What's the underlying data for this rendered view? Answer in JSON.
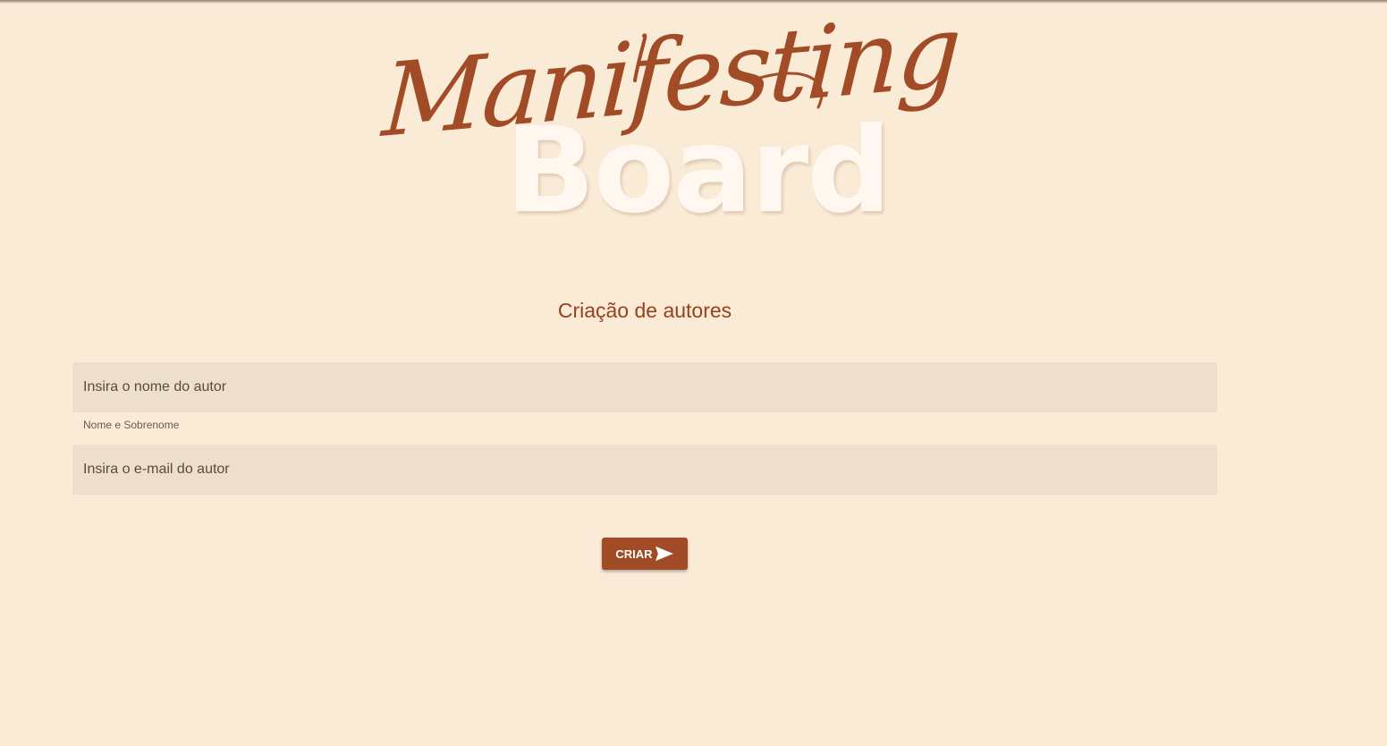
{
  "app": {
    "logo_script": "Manifesting",
    "logo_block": "Board"
  },
  "form": {
    "title": "Criação de autores",
    "name_field": {
      "placeholder": "Insira o nome do autor",
      "hint": "Nome e Sobrenome"
    },
    "email_field": {
      "placeholder": "Insira o e-mail do autor"
    },
    "submit": {
      "label": "CRIAR",
      "icon": "send-icon"
    }
  },
  "colors": {
    "background": "#faebd7",
    "accent": "#a14c26",
    "title": "#99401d",
    "field_background": "#eddfcb",
    "logo_block": "#fff7f0"
  }
}
